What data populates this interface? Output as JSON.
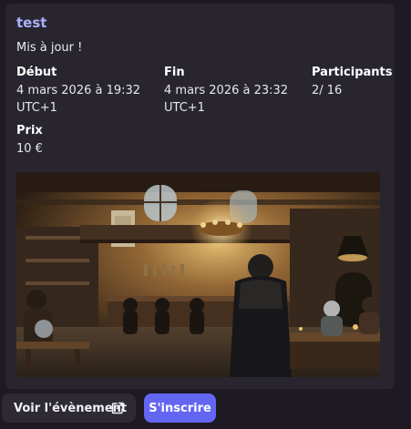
{
  "event": {
    "title": "test",
    "subtitle": "Mis à jour !",
    "start": {
      "label": "Début",
      "value_line1": "4 mars 2026 à 19:32",
      "value_line2": "UTC+1"
    },
    "end": {
      "label": "Fin",
      "value_line1": "4 mars 2026 à 23:32",
      "value_line2": "UTC+1"
    },
    "participants": {
      "label": "Participants",
      "value": "2/ 16"
    },
    "price": {
      "label": "Prix",
      "value": "10 €"
    },
    "image_icon": "medieval-tavern-illustration"
  },
  "actions": {
    "view_label": "Voir l'évènement",
    "view_icon": "external-link-icon",
    "register_label": "S'inscrire"
  },
  "colors": {
    "title": "#aab2ff",
    "card_bg": "#28252f",
    "page_bg": "#1d1a24",
    "primary_button": "#6366f1",
    "secondary_button": "#2d2a33"
  }
}
